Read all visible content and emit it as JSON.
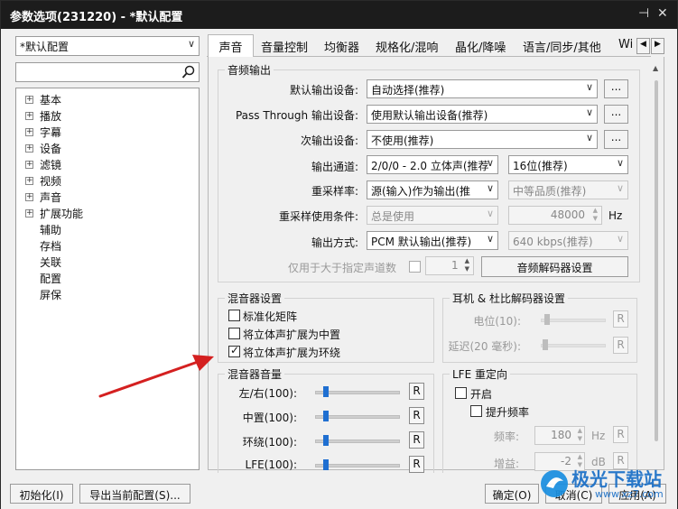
{
  "window": {
    "title": "参数选项(231220) - *默认配置",
    "pin_icon": "pin-icon",
    "close_icon": "close-icon"
  },
  "left": {
    "profile": "*默认配置",
    "search_placeholder": "",
    "tree": [
      {
        "label": "基本",
        "expandable": true
      },
      {
        "label": "播放",
        "expandable": true
      },
      {
        "label": "字幕",
        "expandable": true
      },
      {
        "label": "设备",
        "expandable": true
      },
      {
        "label": "滤镜",
        "expandable": true
      },
      {
        "label": "视频",
        "expandable": true
      },
      {
        "label": "声音",
        "expandable": true
      },
      {
        "label": "扩展功能",
        "expandable": true
      },
      {
        "label": "辅助",
        "expandable": false
      },
      {
        "label": "存档",
        "expandable": false
      },
      {
        "label": "关联",
        "expandable": false
      },
      {
        "label": "配置",
        "expandable": false
      },
      {
        "label": "屏保",
        "expandable": false
      }
    ]
  },
  "tabs": [
    "声音",
    "音量控制",
    "均衡器",
    "规格化/混响",
    "晶化/降噪",
    "语言/同步/其他",
    "Wi"
  ],
  "audio_output": {
    "title": "音频输出",
    "default_device_label": "默认输出设备:",
    "default_device_value": "自动选择(推荐)",
    "passthrough_label": "Pass Through 输出设备:",
    "passthrough_value": "使用默认输出设备(推荐)",
    "secondary_label": "次输出设备:",
    "secondary_value": "不使用(推荐)",
    "more_btn": "...",
    "channel_label": "输出通道:",
    "channel_value": "2/0/0 - 2.0 立体声(推荐",
    "bit_value": "16位(推荐)",
    "resample_label": "重采样率:",
    "resample_value": "源(输入)作为输出(推",
    "quality_value": "中等品质(推荐)",
    "resample_cond_label": "重采样使用条件:",
    "resample_cond_value": "总是使用",
    "rate_value": "48000",
    "rate_unit": "Hz",
    "output_mode_label": "输出方式:",
    "output_mode_value": "PCM 默认输出(推荐)",
    "kbps_value": "640 kbps(推荐)",
    "only_channels_label": "仅用于大于指定声道数",
    "only_channels_value": "1",
    "decoder_btn": "音频解码器设置"
  },
  "mixer": {
    "title": "混音器设置",
    "options": [
      {
        "label": "标准化矩阵",
        "checked": false
      },
      {
        "label": "将立体声扩展为中置",
        "checked": false
      },
      {
        "label": "将立体声扩展为环绕",
        "checked": true
      }
    ]
  },
  "headphone": {
    "title": "耳机 & 杜比解码器设置",
    "level_label": "电位(10):",
    "delay_label": "延迟(20 毫秒):",
    "reset": "R"
  },
  "mixer_volume": {
    "title": "混音器音量",
    "items": [
      {
        "label": "左/右(100):",
        "level": 0.1
      },
      {
        "label": "中置(100):",
        "level": 0.1
      },
      {
        "label": "环绕(100):",
        "level": 0.1
      },
      {
        "label": "LFE(100):",
        "level": 0.1
      }
    ],
    "reset": "R"
  },
  "lfe": {
    "title": "LFE 重定向",
    "enable_label": "开启",
    "boost_label": "提升频率",
    "freq_label": "频率:",
    "freq_value": "180",
    "freq_unit": "Hz",
    "gain_label": "增益:",
    "gain_value": "-2",
    "gain_unit": "dB",
    "reset": "R"
  },
  "footer": {
    "init_btn": "初始化(I)",
    "export_btn": "导出当前配置(S)...",
    "ok_btn": "确定(O)",
    "cancel_btn": "取消(C)",
    "apply_btn": "应用(A)"
  },
  "watermark": {
    "text": "极光下载站",
    "url": "www.xz7.com"
  },
  "colors": {
    "titlebar": "#1c1c1c",
    "accent": "#1f6fd1",
    "arrow": "#d42020"
  }
}
